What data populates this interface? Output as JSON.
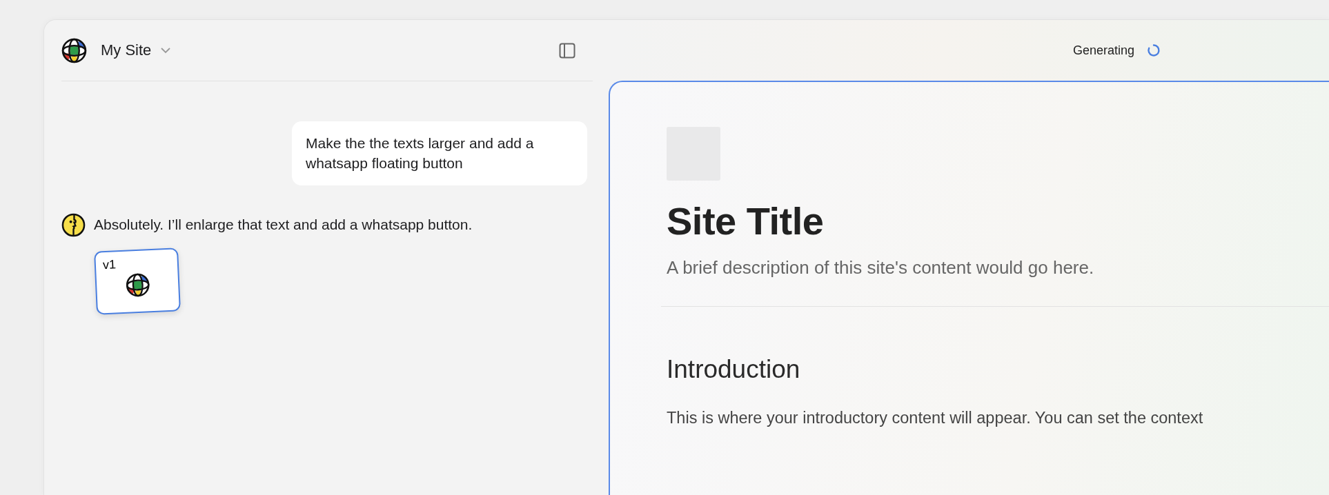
{
  "header": {
    "site_name": "My Site",
    "status": "Generating"
  },
  "chat": {
    "messages": [
      {
        "kind": "user",
        "text": "Make the the texts larger and add a whatsapp floating button"
      },
      {
        "kind": "assistant",
        "text": "Absolutely. I’ll enlarge that text and add a whatsapp button."
      }
    ],
    "versions": [
      {
        "label": "v1",
        "selected": true
      }
    ]
  },
  "preview": {
    "title": "Site Title",
    "description": "A brief description of this site's content would go here.",
    "sections": [
      {
        "heading": "Introduction",
        "body": "This is where your introductory content will appear. You can set the context"
      }
    ]
  }
}
